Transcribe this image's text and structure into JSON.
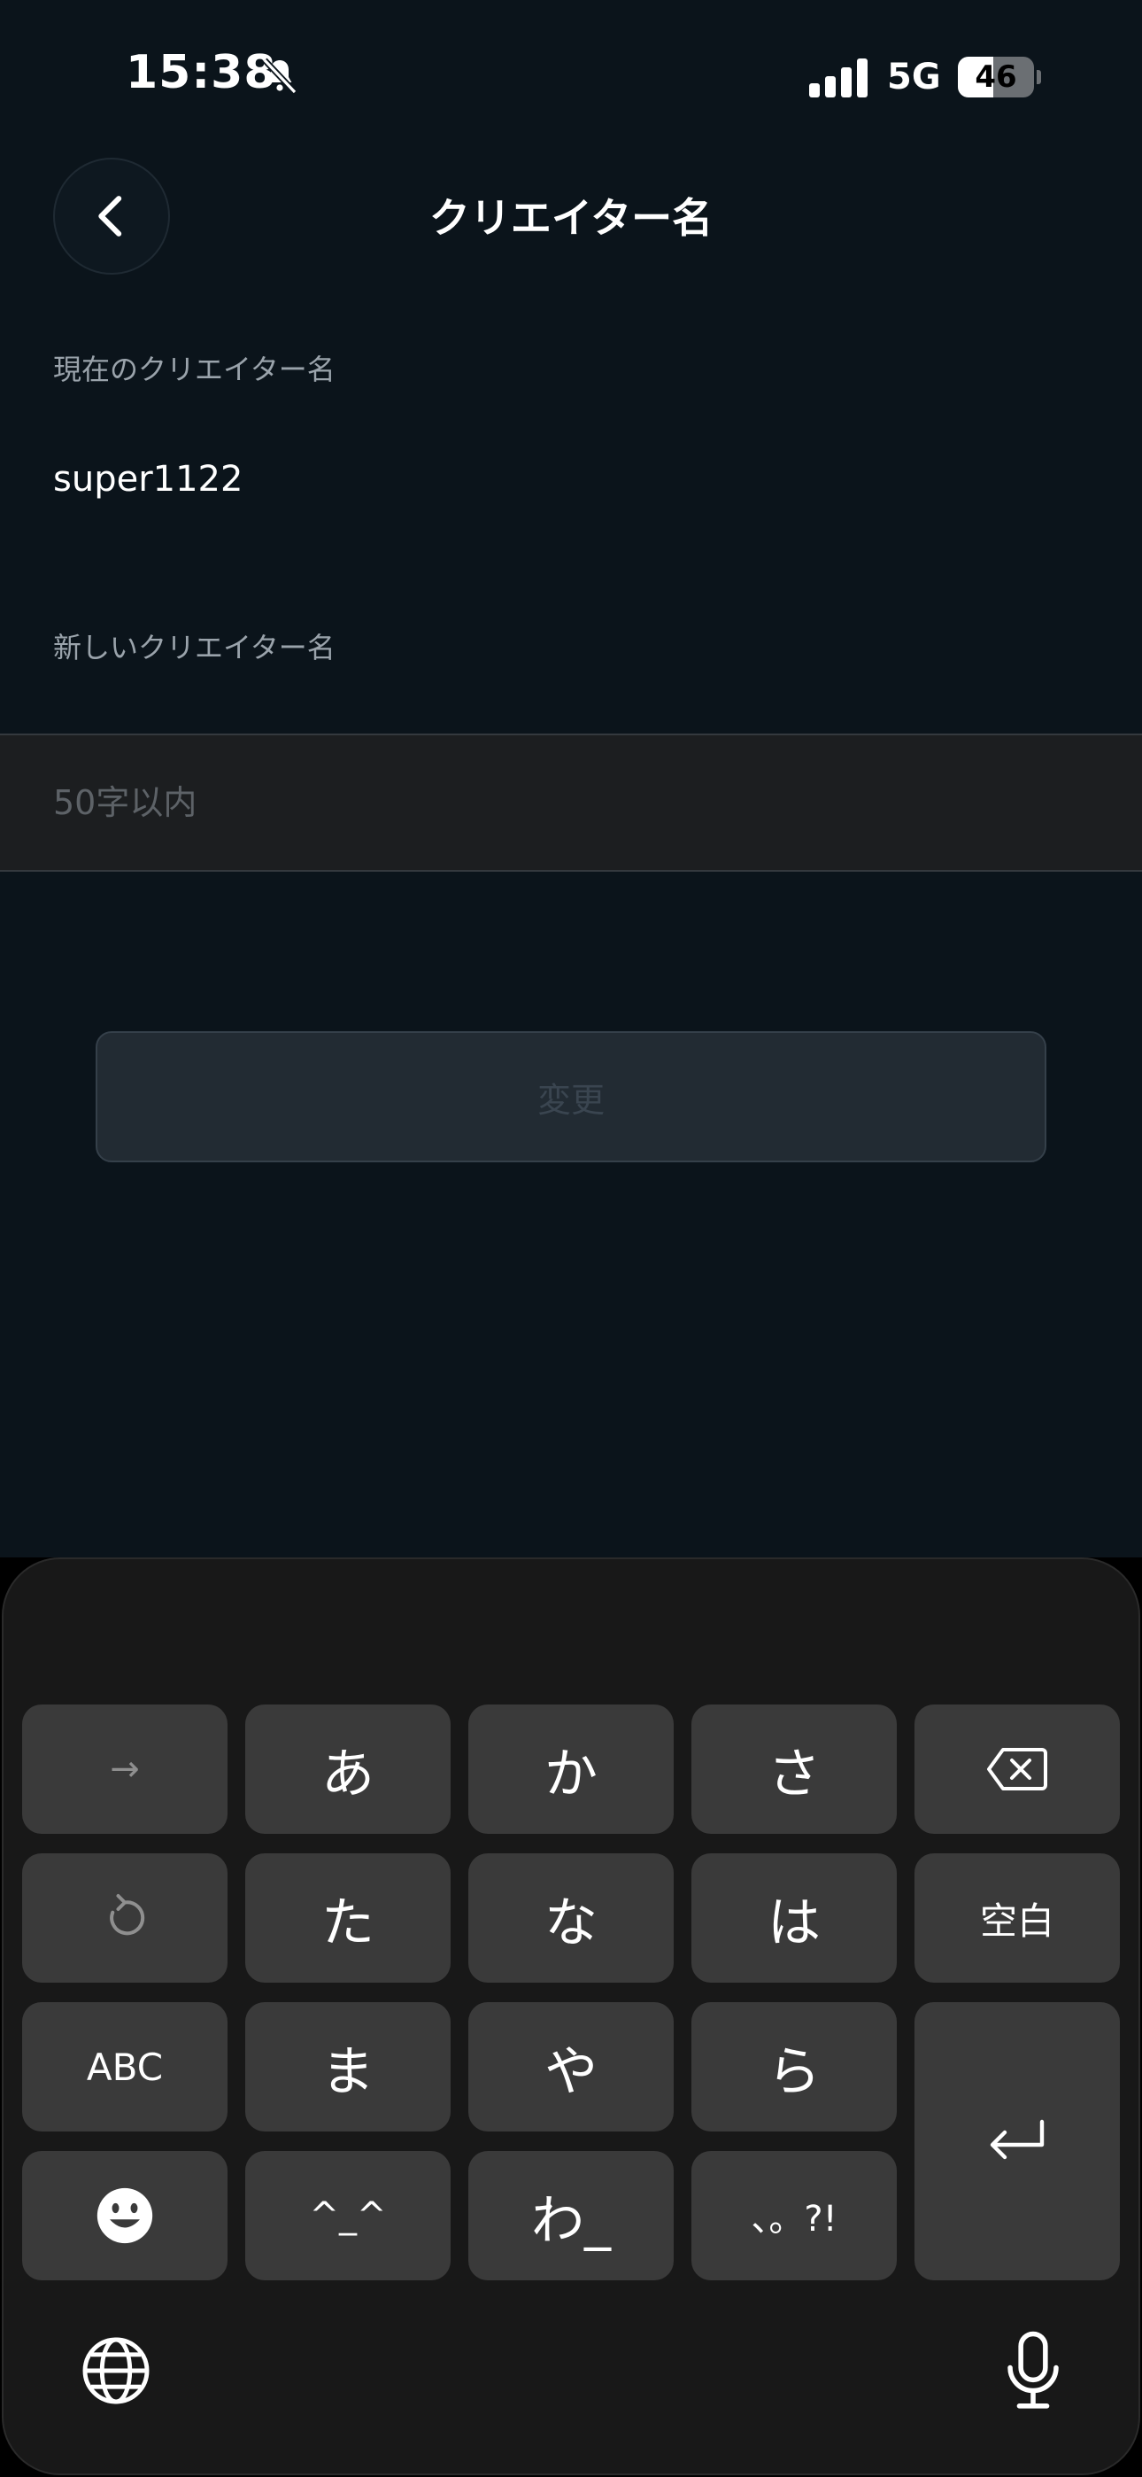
{
  "status_bar": {
    "time": "15:38",
    "network": "5G",
    "battery_level": "46",
    "battery_fraction": 0.46
  },
  "header": {
    "title": "クリエイター名"
  },
  "form": {
    "current_label": "現在のクリエイター名",
    "current_value": "super1122",
    "new_label": "新しいクリエイター名",
    "new_value": "",
    "new_placeholder": "50字以内",
    "submit_label": "変更"
  },
  "keyboard": {
    "rows": [
      [
        "→",
        "あ",
        "か",
        "さ",
        "delete"
      ],
      [
        "undo",
        "た",
        "な",
        "は",
        "空白"
      ],
      [
        "ABC",
        "ま",
        "や",
        "ら",
        "return"
      ],
      [
        "emoji",
        "^_^",
        "わ_",
        "、。?!"
      ]
    ],
    "key_labels": {
      "arrow": "→",
      "a": "あ",
      "ka": "か",
      "sa": "さ",
      "ta": "た",
      "na": "な",
      "ha": "は",
      "space": "空白",
      "abc": "ABC",
      "ma": "ま",
      "ya": "や",
      "ra": "ら",
      "kaomoji": "^_^",
      "wa": "わ_",
      "punct": "、。?!"
    },
    "icons": {
      "delete": "delete-icon",
      "undo": "undo-icon",
      "return": "return-icon",
      "emoji": "emoji-icon",
      "globe": "globe-icon",
      "mic": "microphone-icon"
    }
  }
}
